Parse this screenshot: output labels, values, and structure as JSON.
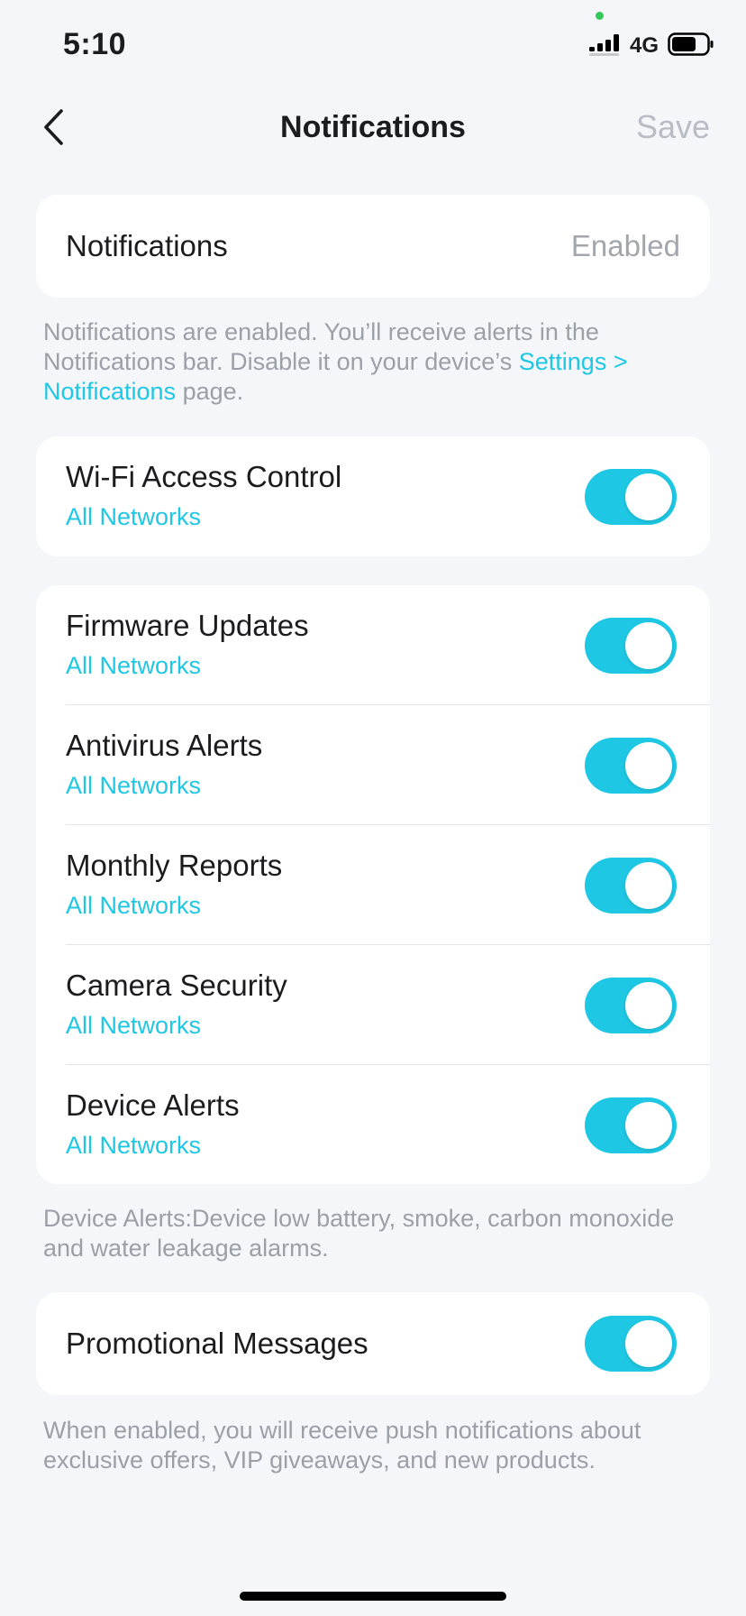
{
  "status_bar": {
    "time": "5:10",
    "network_type": "4G",
    "icons": [
      "signal-bars-icon",
      "battery-icon"
    ]
  },
  "nav": {
    "title": "Notifications",
    "save_label": "Save",
    "back_icon": "chevron-left-icon"
  },
  "notifications_row": {
    "title": "Notifications",
    "value": "Enabled"
  },
  "notifications_note": {
    "text_before": "Notifications are enabled. You’ll receive alerts in the Notifications bar. Disable it on your device’s ",
    "link": "Settings > Notifications",
    "text_after": " page."
  },
  "wifi_row": {
    "title": "Wi-Fi Access Control",
    "subtitle": "All Networks",
    "enabled": true
  },
  "alert_rows": [
    {
      "title": "Firmware Updates",
      "subtitle": "All Networks",
      "enabled": true
    },
    {
      "title": "Antivirus Alerts",
      "subtitle": "All Networks",
      "enabled": true
    },
    {
      "title": "Monthly Reports",
      "subtitle": "All Networks",
      "enabled": true
    },
    {
      "title": "Camera Security",
      "subtitle": "All Networks",
      "enabled": true
    },
    {
      "title": "Device Alerts",
      "subtitle": "All Networks",
      "enabled": true
    }
  ],
  "device_alerts_note": "Device Alerts:Device low battery, smoke, carbon monoxide and water leakage alarms.",
  "promo_row": {
    "title": "Promotional Messages",
    "enabled": true
  },
  "promo_note": "When enabled, you will receive push notifications about exclusive offers, VIP giveaways, and new products.",
  "colors": {
    "accent": "#1ec8e4",
    "background": "#f4f6fa",
    "card": "#ffffff",
    "muted_text": "#9b9fa6",
    "disabled_text": "#b8bcc4"
  }
}
